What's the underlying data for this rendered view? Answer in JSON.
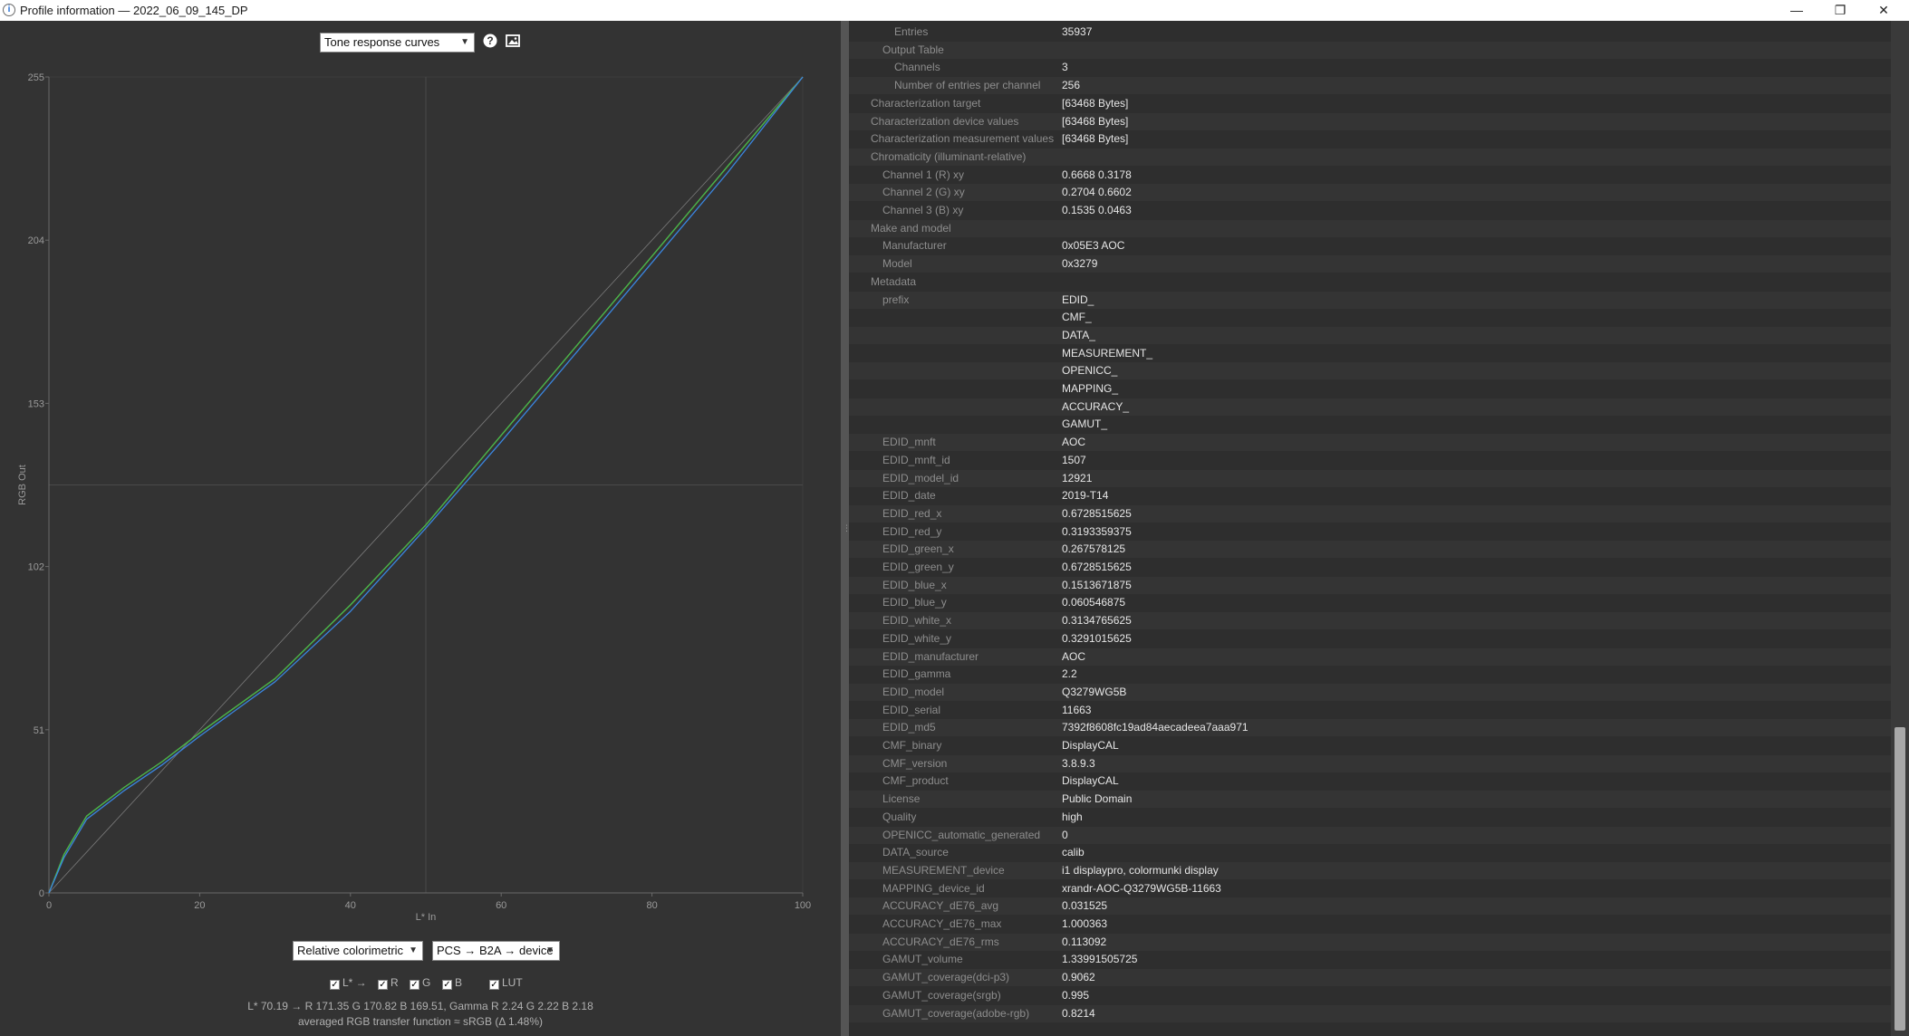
{
  "window": {
    "title": "Profile information — 2022_06_09_145_DP",
    "minimize_glyph": "—",
    "restore_glyph": "❐",
    "close_glyph": "✕",
    "icon_glyph": "i"
  },
  "toolbar": {
    "view_select": "Tone response curves",
    "help_icon": "help-icon",
    "save_image_icon": "image-icon"
  },
  "chart_data": {
    "type": "line",
    "title": "",
    "xlabel": "L* In",
    "ylabel": "RGB Out",
    "xlim": [
      0,
      100
    ],
    "ylim": [
      0,
      255
    ],
    "x_ticks": [
      "0",
      "20",
      "40",
      "60",
      "80",
      "100"
    ],
    "y_ticks": [
      "0",
      "51",
      "102",
      "153",
      "204",
      "255"
    ],
    "grid": "center crosshair",
    "series": [
      {
        "name": "L*",
        "color": "#9a9a9a",
        "x": [
          0,
          100
        ],
        "y": [
          0,
          255
        ]
      },
      {
        "name": "R",
        "color": "#e64a3c",
        "x": [
          0,
          2,
          5,
          10,
          15,
          20,
          30,
          40,
          50,
          60,
          70,
          80,
          90,
          100
        ],
        "y": [
          0,
          12,
          24,
          33,
          41,
          50,
          67,
          90,
          115,
          143,
          171,
          199,
          227,
          255
        ]
      },
      {
        "name": "G",
        "color": "#3bbd4a",
        "x": [
          0,
          2,
          5,
          10,
          15,
          20,
          30,
          40,
          50,
          60,
          70,
          80,
          90,
          100
        ],
        "y": [
          0,
          12,
          24,
          33,
          41,
          50,
          67,
          90,
          115,
          143,
          171,
          199,
          227,
          255
        ]
      },
      {
        "name": "B",
        "color": "#3a86e0",
        "x": [
          0,
          2,
          5,
          10,
          15,
          20,
          30,
          40,
          50,
          60,
          70,
          80,
          90,
          100
        ],
        "y": [
          0,
          11,
          23,
          32,
          40,
          49,
          66,
          88,
          114,
          141,
          169,
          197,
          225,
          255
        ]
      }
    ]
  },
  "controls": {
    "intent_select": "Relative colorimetric",
    "direction_select": "PCS → B2A → device",
    "checkboxes": [
      {
        "label": "L* →",
        "checked": true
      },
      {
        "label": "R",
        "checked": true
      },
      {
        "label": "G",
        "checked": true
      },
      {
        "label": "B",
        "checked": true
      },
      {
        "label": "LUT",
        "checked": true
      }
    ],
    "check_glyph": "✓",
    "info_line1": "L* 70.19 → R 171.35 G 170.82 B 169.51, Gamma R 2.24 G 2.22 B 2.18",
    "info_line2": "averaged RGB transfer function ≈ sRGB (Δ 1.48%)"
  },
  "profile_rows": [
    {
      "key": "Entries",
      "value": "35937",
      "indent": 2
    },
    {
      "key": "Output Table",
      "value": "",
      "indent": 1
    },
    {
      "key": "Channels",
      "value": "3",
      "indent": 2
    },
    {
      "key": "Number of entries per channel",
      "value": "256",
      "indent": 2
    },
    {
      "key": "Characterization target",
      "value": "[63468 Bytes]",
      "indent": 0
    },
    {
      "key": "Characterization device values",
      "value": "[63468 Bytes]",
      "indent": 0
    },
    {
      "key": "Characterization measurement values",
      "value": "[63468 Bytes]",
      "indent": 0
    },
    {
      "key": "Chromaticity (illuminant-relative)",
      "value": "",
      "indent": 0
    },
    {
      "key": "Channel 1 (R) xy",
      "value": "0.6668 0.3178",
      "indent": 1
    },
    {
      "key": "Channel 2 (G) xy",
      "value": "0.2704 0.6602",
      "indent": 1
    },
    {
      "key": "Channel 3 (B) xy",
      "value": "0.1535 0.0463",
      "indent": 1
    },
    {
      "key": "Make and model",
      "value": "",
      "indent": 0
    },
    {
      "key": "Manufacturer",
      "value": "0x05E3 AOC",
      "indent": 1
    },
    {
      "key": "Model",
      "value": "0x3279",
      "indent": 1
    },
    {
      "key": "Metadata",
      "value": "",
      "indent": 0
    },
    {
      "key": "prefix",
      "value": "EDID_",
      "indent": 1
    },
    {
      "key": "",
      "value": "CMF_",
      "indent": 1
    },
    {
      "key": "",
      "value": "DATA_",
      "indent": 1
    },
    {
      "key": "",
      "value": "MEASUREMENT_",
      "indent": 1
    },
    {
      "key": "",
      "value": "OPENICC_",
      "indent": 1
    },
    {
      "key": "",
      "value": "MAPPING_",
      "indent": 1
    },
    {
      "key": "",
      "value": "ACCURACY_",
      "indent": 1
    },
    {
      "key": "",
      "value": "GAMUT_",
      "indent": 1
    },
    {
      "key": "EDID_mnft",
      "value": "AOC",
      "indent": 1
    },
    {
      "key": "EDID_mnft_id",
      "value": "1507",
      "indent": 1
    },
    {
      "key": "EDID_model_id",
      "value": "12921",
      "indent": 1
    },
    {
      "key": "EDID_date",
      "value": "2019-T14",
      "indent": 1
    },
    {
      "key": "EDID_red_x",
      "value": "0.6728515625",
      "indent": 1
    },
    {
      "key": "EDID_red_y",
      "value": "0.3193359375",
      "indent": 1
    },
    {
      "key": "EDID_green_x",
      "value": "0.267578125",
      "indent": 1
    },
    {
      "key": "EDID_green_y",
      "value": "0.6728515625",
      "indent": 1
    },
    {
      "key": "EDID_blue_x",
      "value": "0.1513671875",
      "indent": 1
    },
    {
      "key": "EDID_blue_y",
      "value": "0.060546875",
      "indent": 1
    },
    {
      "key": "EDID_white_x",
      "value": "0.3134765625",
      "indent": 1
    },
    {
      "key": "EDID_white_y",
      "value": "0.3291015625",
      "indent": 1
    },
    {
      "key": "EDID_manufacturer",
      "value": "AOC",
      "indent": 1
    },
    {
      "key": "EDID_gamma",
      "value": "2.2",
      "indent": 1
    },
    {
      "key": "EDID_model",
      "value": "Q3279WG5B",
      "indent": 1
    },
    {
      "key": "EDID_serial",
      "value": "11663",
      "indent": 1
    },
    {
      "key": "EDID_md5",
      "value": "7392f8608fc19ad84aecadeea7aaa971",
      "indent": 1
    },
    {
      "key": "CMF_binary",
      "value": "DisplayCAL",
      "indent": 1
    },
    {
      "key": "CMF_version",
      "value": "3.8.9.3",
      "indent": 1
    },
    {
      "key": "CMF_product",
      "value": "DisplayCAL",
      "indent": 1
    },
    {
      "key": "License",
      "value": "Public Domain",
      "indent": 1
    },
    {
      "key": "Quality",
      "value": "high",
      "indent": 1
    },
    {
      "key": "OPENICC_automatic_generated",
      "value": "0",
      "indent": 1
    },
    {
      "key": "DATA_source",
      "value": "calib",
      "indent": 1
    },
    {
      "key": "MEASUREMENT_device",
      "value": "i1 displaypro, colormunki display",
      "indent": 1
    },
    {
      "key": "MAPPING_device_id",
      "value": "xrandr-AOC-Q3279WG5B-11663",
      "indent": 1
    },
    {
      "key": "ACCURACY_dE76_avg",
      "value": "0.031525",
      "indent": 1
    },
    {
      "key": "ACCURACY_dE76_max",
      "value": "1.000363",
      "indent": 1
    },
    {
      "key": "ACCURACY_dE76_rms",
      "value": "0.113092",
      "indent": 1
    },
    {
      "key": "GAMUT_volume",
      "value": "1.33991505725",
      "indent": 1
    },
    {
      "key": "GAMUT_coverage(dci-p3)",
      "value": "0.9062",
      "indent": 1
    },
    {
      "key": "GAMUT_coverage(srgb)",
      "value": "0.995",
      "indent": 1
    },
    {
      "key": "GAMUT_coverage(adobe-rgb)",
      "value": "0.8214",
      "indent": 1
    }
  ],
  "scrollbar": {
    "position_fraction": 0.95,
    "visible_fraction": 0.3
  }
}
